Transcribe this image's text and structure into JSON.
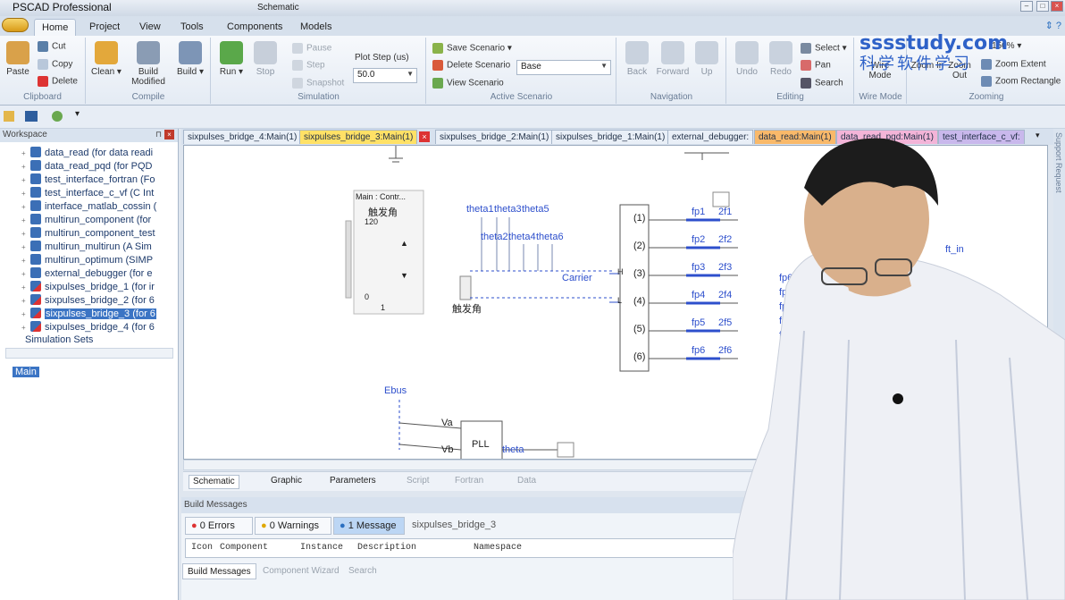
{
  "window": {
    "app_title": "PSCAD Professional",
    "context_title": "Schematic"
  },
  "menu": {
    "tabs": [
      "Home",
      "Project",
      "View",
      "Tools",
      "Components",
      "Models"
    ],
    "active": "Home"
  },
  "ribbon": {
    "clipboard": {
      "label": "Clipboard",
      "paste": "Paste",
      "cut": "Cut",
      "copy": "Copy",
      "delete": "Delete"
    },
    "compile": {
      "label": "Compile",
      "clean": "Clean",
      "build_modified": "Build Modified",
      "build": "Build"
    },
    "simulation": {
      "label": "Simulation",
      "run": "Run",
      "stop": "Stop",
      "pause": "Pause",
      "step": "Step",
      "snapshot": "Snapshot",
      "plot_step_label": "Plot Step (us)",
      "plot_step_value": "50.0"
    },
    "active_scenario": {
      "label": "Active Scenario",
      "save": "Save Scenario",
      "delete": "Delete Scenario",
      "view": "View Scenario",
      "current": "Base"
    },
    "navigation": {
      "label": "Navigation",
      "back": "Back",
      "forward": "Forward",
      "up": "Up"
    },
    "editing": {
      "label": "Editing",
      "undo": "Undo",
      "redo": "Redo",
      "select": "Select",
      "pan": "Pan",
      "search": "Search"
    },
    "wire_mode": {
      "label": "Wire Mode",
      "button": "Wire Mode"
    },
    "zooming": {
      "label": "Zooming",
      "zoom_in": "Zoom In",
      "zoom_out": "Zoom Out",
      "zoom_level": "150%",
      "zoom_extent": "Zoom Extent",
      "zoom_rect": "Zoom Rectangle"
    }
  },
  "workspace": {
    "title": "Workspace",
    "items": [
      {
        "label": "data_read (for data readi"
      },
      {
        "label": "data_read_pqd (for PQD"
      },
      {
        "label": "test_interface_fortran (Fo"
      },
      {
        "label": "test_interface_c_vf (C Int"
      },
      {
        "label": "interface_matlab_cossin ("
      },
      {
        "label": "multirun_component (for"
      },
      {
        "label": "multirun_component_test"
      },
      {
        "label": "multirun_multirun (A Sim"
      },
      {
        "label": "multirun_optimum (SIMP"
      },
      {
        "label": "external_debugger (for e"
      },
      {
        "label": "sixpulses_bridge_1 (for ir"
      },
      {
        "label": "sixpulses_bridge_2 (for 6"
      },
      {
        "label": "sixpulses_bridge_3 (for 6"
      },
      {
        "label": "sixpulses_bridge_4 (for 6"
      }
    ],
    "selected_index": 12,
    "simulation_sets": "Simulation Sets",
    "main_node": "Main"
  },
  "doc_tabs": [
    "sixpulses_bridge_4:Main(1)",
    "sixpulses_bridge_3:Main(1)",
    "sixpulses_bridge_2:Main(1)",
    "sixpulses_bridge_1:Main(1)",
    "external_debugger:",
    "data_read:Main(1)",
    "data_read_pqd:Main(1)",
    "test_interface_c_vf:"
  ],
  "schematic": {
    "control_title": "Main : Contr...",
    "control_name": "触发角",
    "slider_max": "120",
    "slider_min": "0",
    "slider_value": "1",
    "thetas_top": [
      "theta1",
      "theta3",
      "theta5"
    ],
    "thetas_bottom": [
      "theta2",
      "theta4",
      "theta6"
    ],
    "carrier": "Carrier",
    "trigger_label": "触发角",
    "ports": [
      "(1)",
      "(2)",
      "(3)",
      "(4)",
      "(5)",
      "(6)"
    ],
    "hl": [
      "H",
      "L"
    ],
    "fp_left": [
      "fp1",
      "fp2",
      "fp3",
      "fp4",
      "fp5",
      "fp6"
    ],
    "fp_right": [
      "2f1",
      "2f2",
      "2f3",
      "2f4",
      "2f5",
      "2f6"
    ],
    "right_fp": [
      "fp6",
      "fp5",
      "fp4",
      "fp3",
      "fp2"
    ],
    "ebus": "Ebus",
    "va": "Va",
    "vb": "Vb",
    "pll": "PLL",
    "theta": "theta",
    "ft_in": "ft_in"
  },
  "view_tabs": {
    "schematic": "Schematic",
    "graphic": "Graphic",
    "parameters": "Parameters",
    "script": "Script",
    "fortran": "Fortran",
    "data": "Data"
  },
  "build_messages": {
    "title": "Build Messages",
    "errors": "0 Errors",
    "warnings": "0 Warnings",
    "messages": "1 Message",
    "project": "sixpulses_bridge_3",
    "columns": [
      "Icon",
      "Component",
      "Instance",
      "Description",
      "Namespace"
    ],
    "bottom_tabs": [
      "Build Messages",
      "Component Wizard",
      "Search"
    ]
  },
  "side_strip": "Support Request",
  "watermark": {
    "line1": "sssstudy.com",
    "line2": "科学软件学习"
  },
  "colors": {
    "active_tab": "#ffe166",
    "schematic_blue": "#2d4fcc",
    "selection": "#3b74c4"
  }
}
